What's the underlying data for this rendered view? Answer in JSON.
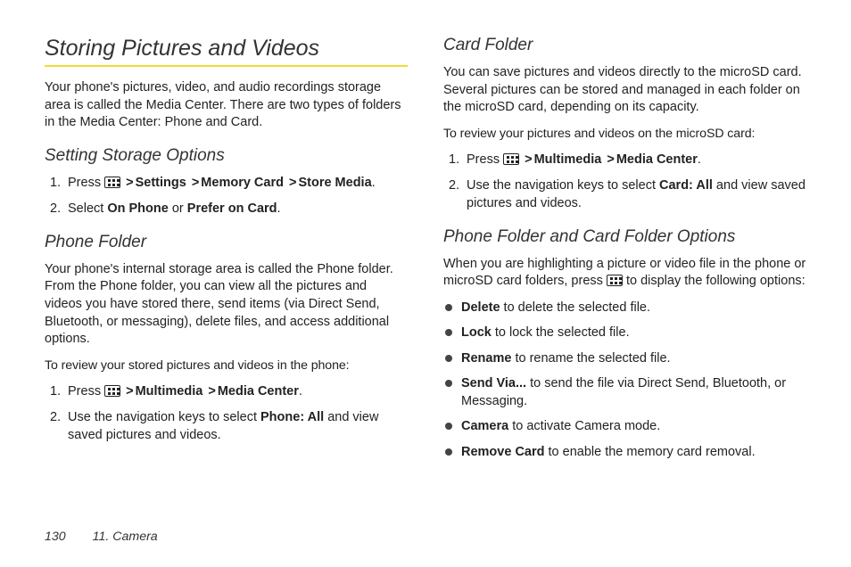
{
  "footer": {
    "page_num": "130",
    "section": "11. Camera"
  },
  "left": {
    "h1": "Storing Pictures and Videos",
    "intro": "Your phone's pictures, video, and audio recordings storage area is called the Media Center. There are two types of folders in the Media Center: Phone and Card.",
    "h2a": "Setting Storage Options",
    "step1_press": "Press ",
    "step1_nav1": "Settings",
    "step1_nav2": "Memory Card",
    "step1_nav3": "Store Media",
    "step2_pre": "Select ",
    "step2_opt1": "On Phone",
    "step2_mid": " or ",
    "step2_opt2": "Prefer on Card",
    "h2b": "Phone Folder",
    "pf_para": "Your phone's internal storage area is called the Phone folder. From the Phone folder, you can view all the pictures and videos you have stored there, send items (via Direct Send, Bluetooth, or messaging), delete files, and access additional options.",
    "pf_lead": "To review your stored pictures and videos in the phone:",
    "pf_s1_press": "Press ",
    "pf_s1_nav1": "Multimedia",
    "pf_s1_nav2": "Media Center",
    "pf_s2_pre": "Use the navigation keys to select ",
    "pf_s2_target": "Phone: All",
    "pf_s2_post": " and view saved pictures and videos."
  },
  "right": {
    "h2a": "Card Folder",
    "cf_para": "You can save pictures and videos directly to the microSD card. Several pictures can be stored and managed in each folder on the microSD card, depending on its capacity.",
    "cf_lead": "To review your pictures and videos on the microSD card:",
    "cf_s1_press": "Press ",
    "cf_s1_nav1": "Multimedia",
    "cf_s1_nav2": "Media Center",
    "cf_s2_pre": "Use the navigation keys to select ",
    "cf_s2_target": "Card: All",
    "cf_s2_post": " and view saved pictures and videos.",
    "h2b": "Phone Folder and Card Folder Options",
    "opt_intro_pre": "When you are highlighting a picture or video file in the phone or microSD card folders, press ",
    "opt_intro_post": " to display the following options:",
    "b1_label": "Delete",
    "b1_text": " to delete the selected file.",
    "b2_label": "Lock",
    "b2_text": " to lock the selected file.",
    "b3_label": "Rename",
    "b3_text": " to rename the selected file.",
    "b4_label": "Send Via...",
    "b4_text": " to send the file via Direct Send, Bluetooth, or Messaging.",
    "b5_label": "Camera",
    "b5_text": " to activate Camera mode.",
    "b6_label": "Remove Card",
    "b6_text": " to enable the memory card removal."
  },
  "gt": ">",
  "period": "."
}
